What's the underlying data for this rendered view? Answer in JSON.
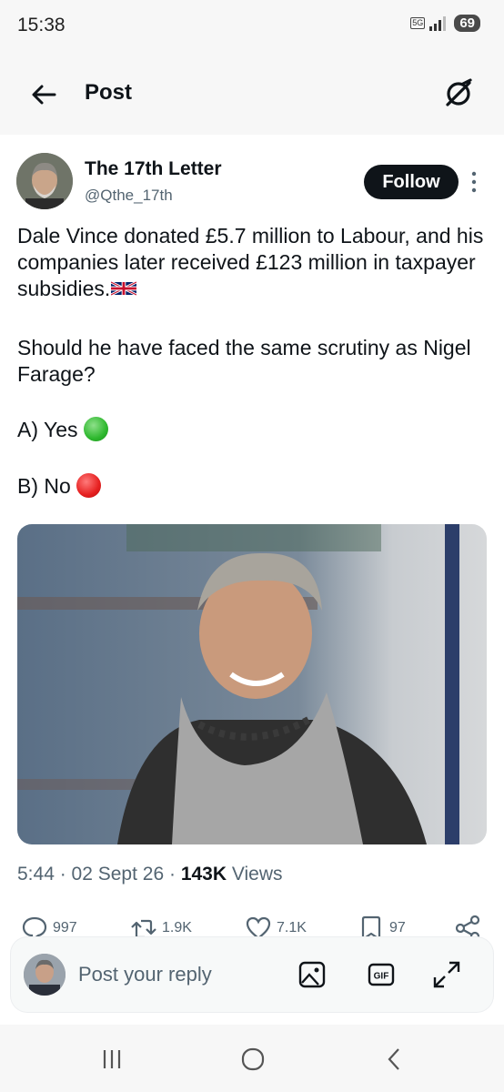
{
  "status_bar": {
    "time": "15:38",
    "network": "5G",
    "battery": "69"
  },
  "header": {
    "title": "Post"
  },
  "author": {
    "name": "The 17th Letter",
    "handle": "@Qthe_17th",
    "follow_label": "Follow"
  },
  "tweet": {
    "line1": "Dale Vince donated £5.7 million to Labour, and his companies later received £123 million in taxpayer subsidies.",
    "line2": "Should he have faced the same scrutiny as Nigel Farage?",
    "option_a": "A) Yes",
    "option_b": "B) No"
  },
  "meta": {
    "time": "5:44",
    "sep1": " · ",
    "date": "02 Sept 26",
    "sep2": " · ",
    "views_count": "143K",
    "views_label": " Views"
  },
  "actions": {
    "replies": "997",
    "reposts": "1.9K",
    "likes": "7.1K",
    "bookmarks": "97"
  },
  "reply": {
    "placeholder": "Post your reply"
  },
  "colors": {
    "text": "#0f1419",
    "secondary": "#536471",
    "follow_bg": "#0f1419",
    "bar_bg": "#f7f7f7"
  },
  "icons": [
    "back-arrow-icon",
    "grok-icon",
    "more-vertical-icon",
    "reply-icon",
    "repost-icon",
    "like-icon",
    "bookmark-icon",
    "share-icon",
    "image-icon",
    "gif-icon",
    "expand-icon"
  ]
}
